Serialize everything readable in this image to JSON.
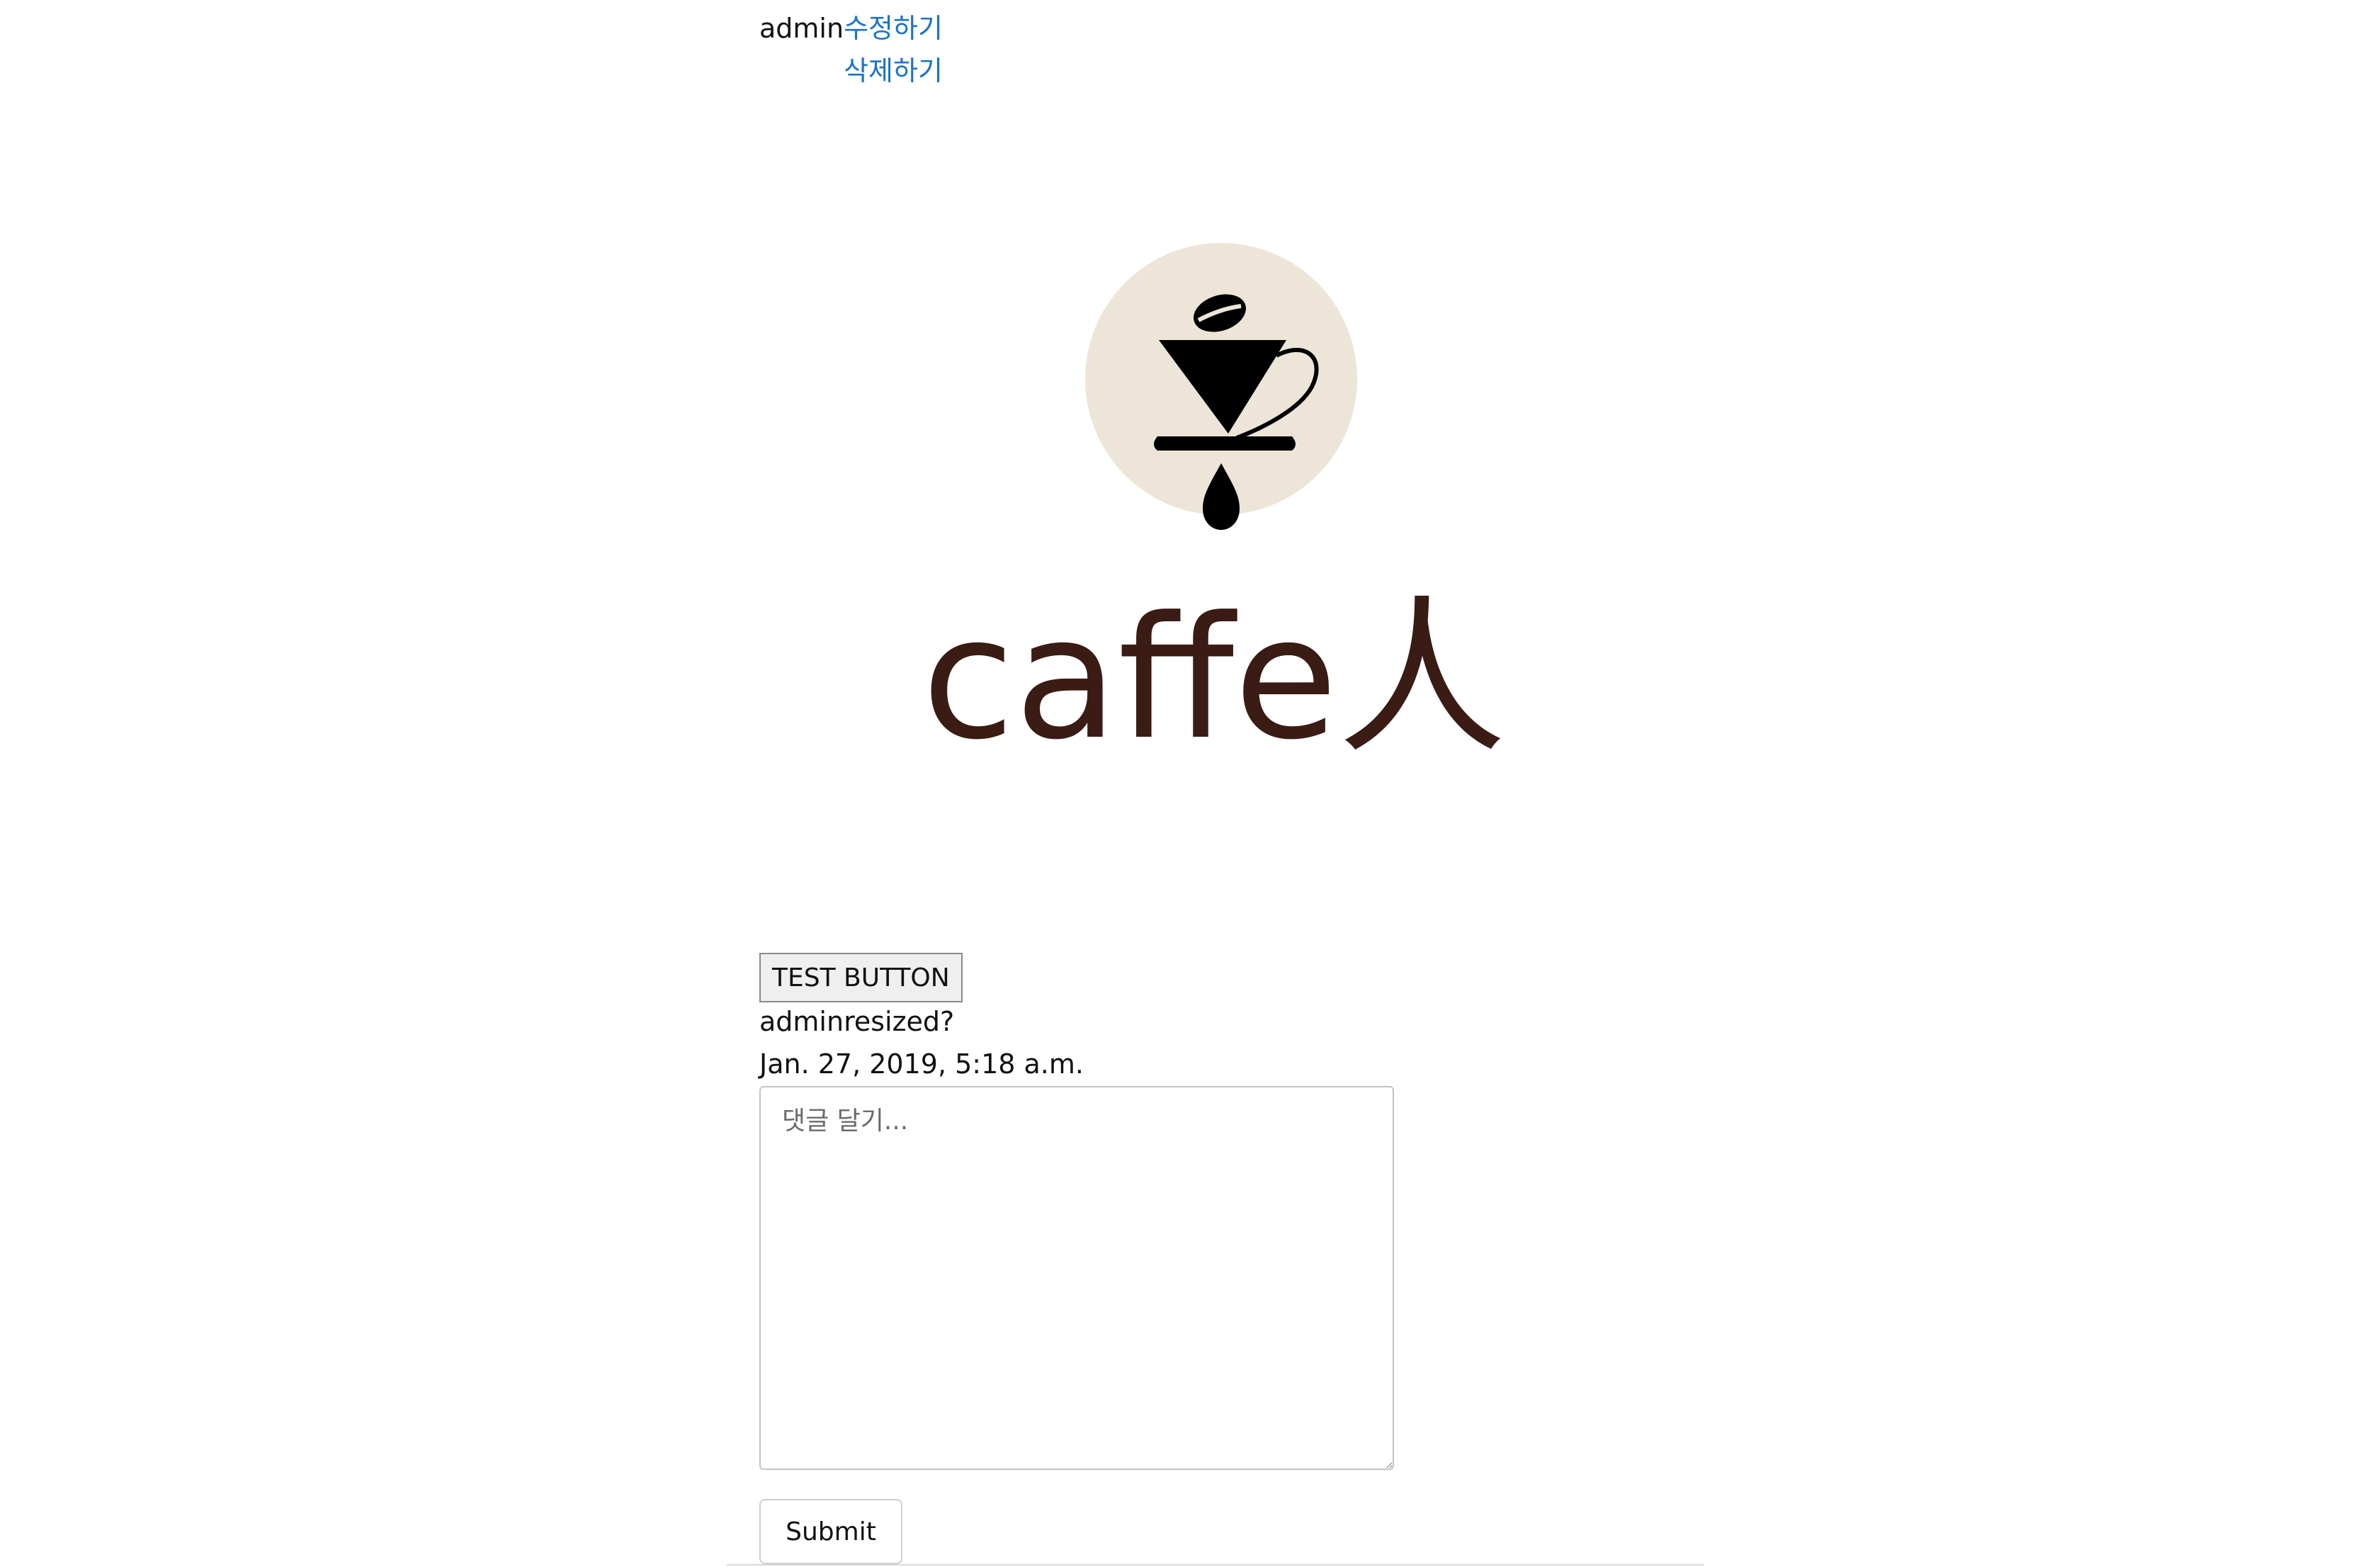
{
  "post": {
    "author": "admin",
    "actions": {
      "edit_label": "수정하기",
      "delete_label": "삭제하기"
    },
    "image": {
      "brand_text": "caffe人",
      "circle_color": "#EDE5D7",
      "ink_color": "#000000",
      "text_color": "#3A1C14"
    },
    "test_button_label": "TEST BUTTON",
    "caption": "adminresized?",
    "timestamp": "Jan. 27, 2019, 5:18 a.m."
  },
  "comment": {
    "placeholder": "댓글 달기...",
    "value": "",
    "submit_label": "Submit"
  },
  "colors": {
    "link": "#1A73C8",
    "button_bg": "#EFEFEF",
    "border": "#C4C4C4"
  }
}
